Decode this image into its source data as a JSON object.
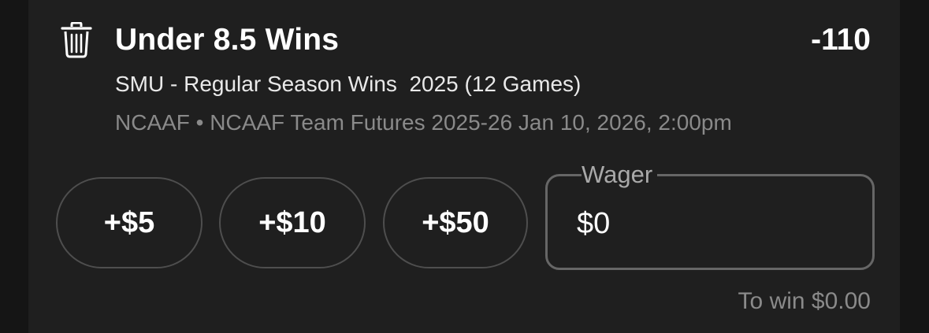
{
  "bet": {
    "title": "Under 8.5 Wins",
    "odds": "-110",
    "subtitle": "SMU - Regular Season Wins  2025 (12 Games)",
    "meta": "NCAAF • NCAAF Team Futures 2025-26 Jan 10, 2026, 2:00pm"
  },
  "quick_add": {
    "five": "+$5",
    "ten": "+$10",
    "fifty": "+$50"
  },
  "wager": {
    "label": "Wager",
    "value": "$0"
  },
  "to_win": "To win $0.00",
  "icons": {
    "delete": "trash-icon"
  }
}
